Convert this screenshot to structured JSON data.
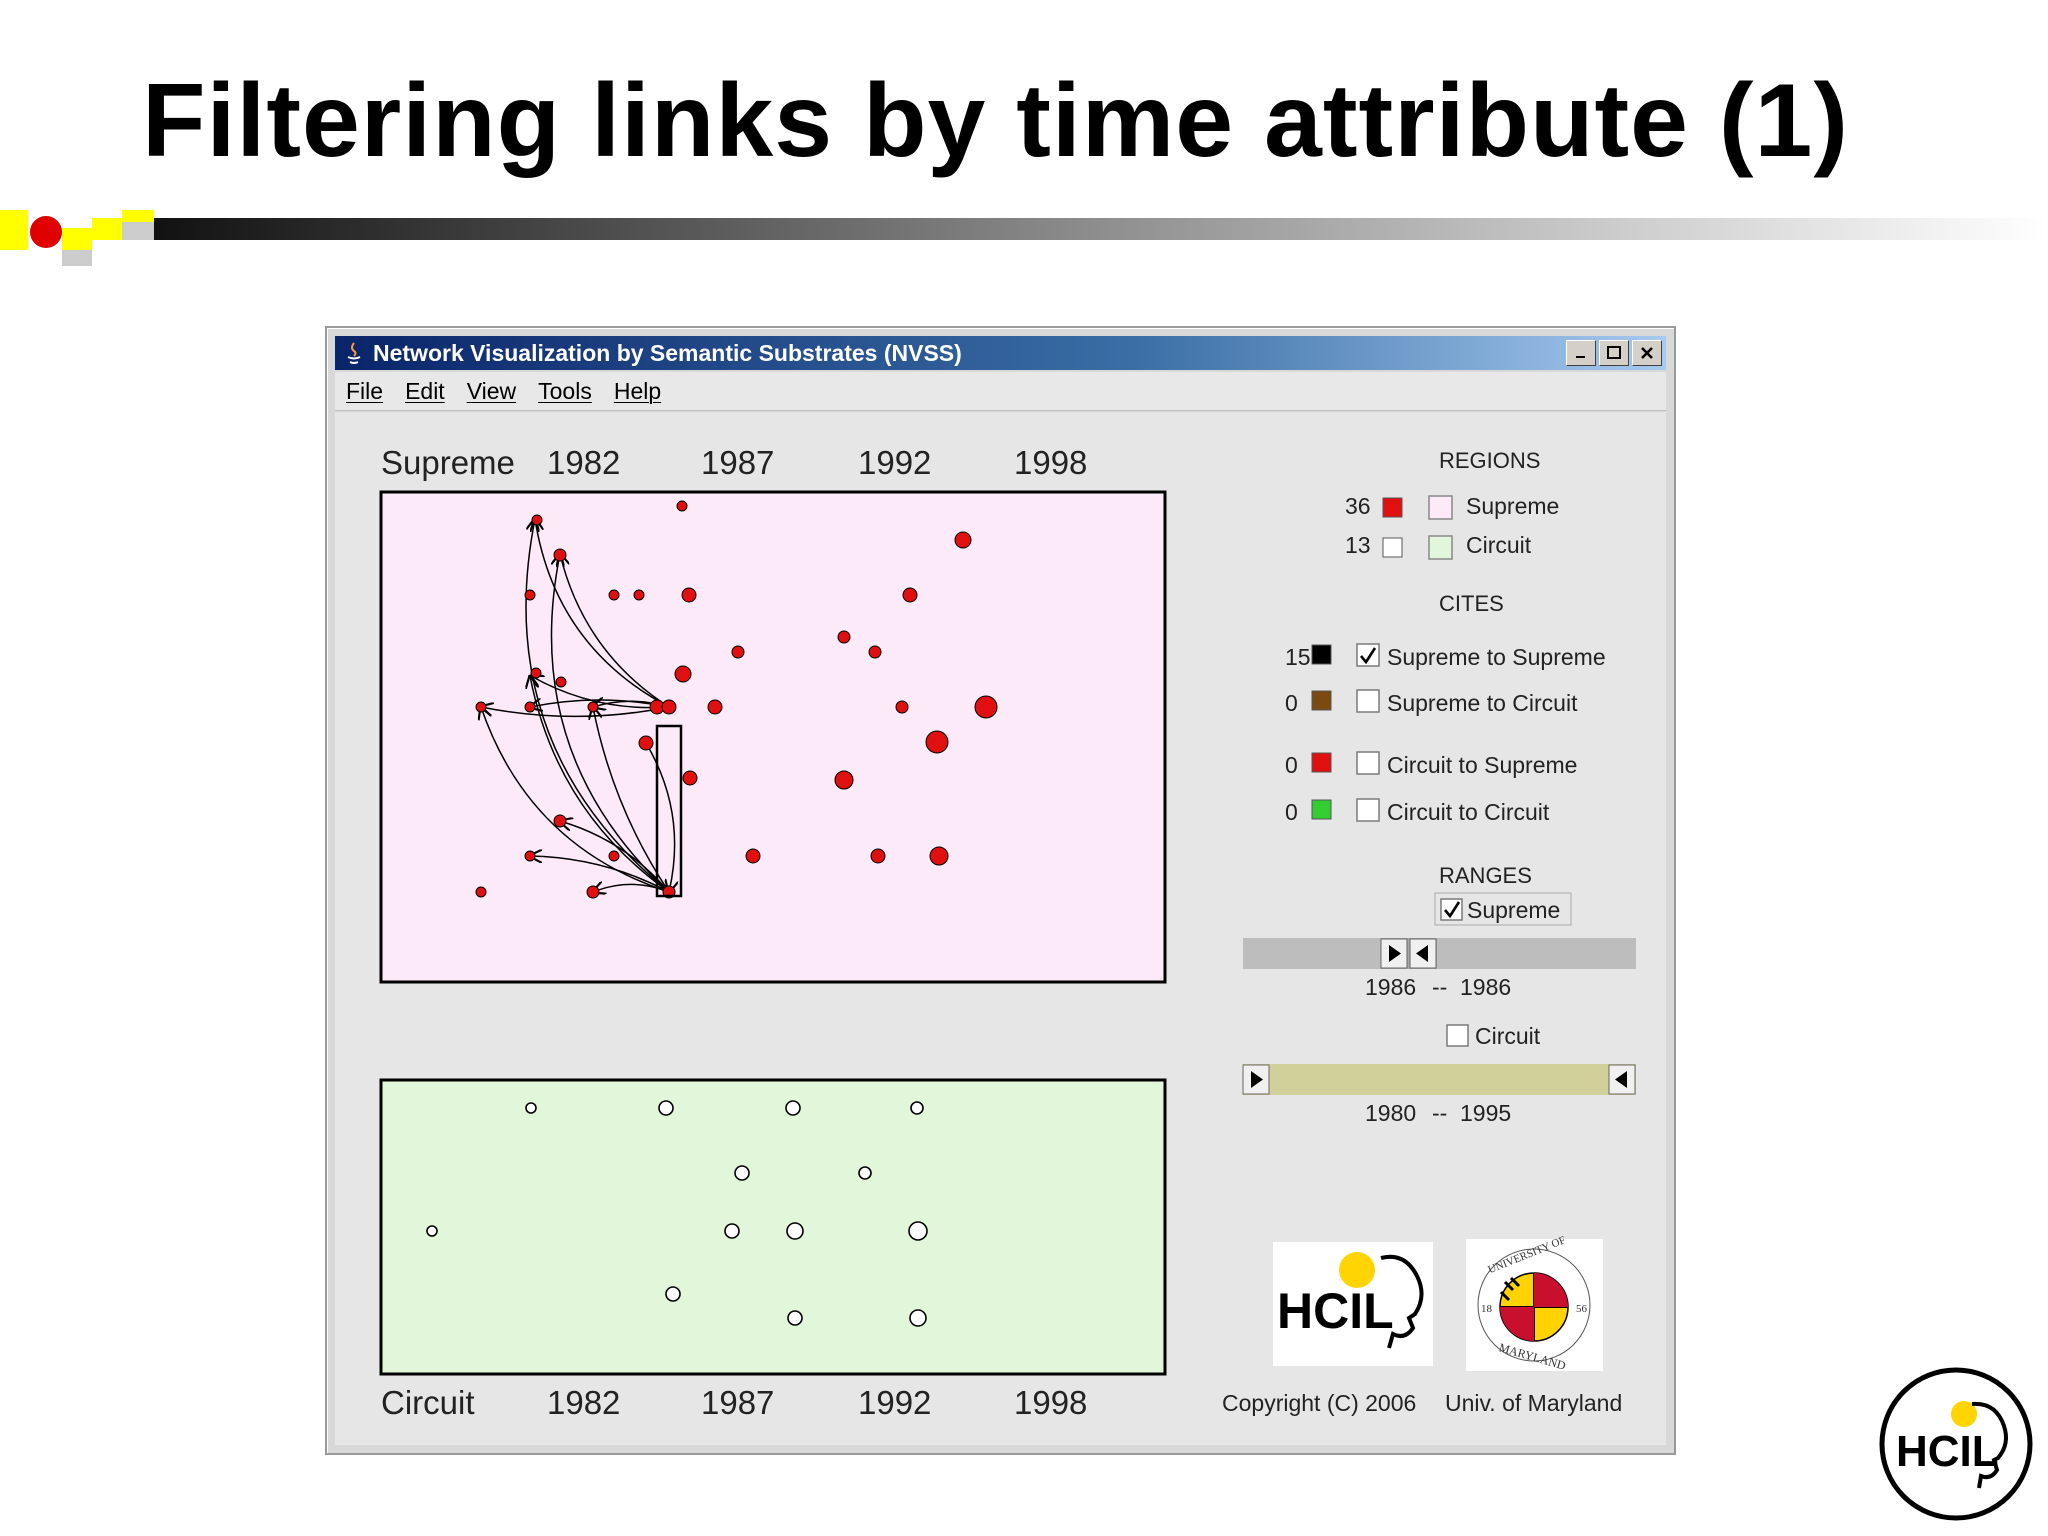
{
  "slide": {
    "title": "Filtering links by time attribute (1)"
  },
  "window": {
    "title": "Network Visualization by Semantic Substrates (NVSS)",
    "menu": [
      "File",
      "Edit",
      "View",
      "Tools",
      "Help"
    ]
  },
  "top_panel": {
    "label": "Supreme",
    "years": [
      "1982",
      "1987",
      "1992",
      "1998"
    ],
    "fill": "#fceaf8"
  },
  "bottom_panel": {
    "label": "Circuit",
    "years": [
      "1982",
      "1987",
      "1992",
      "1998"
    ],
    "fill": "#e2f6da"
  },
  "regions": {
    "heading": "REGIONS",
    "items": [
      {
        "count": "36",
        "label": "Supreme",
        "swatch": "#e01010",
        "region_color": "#fceaf8"
      },
      {
        "count": "13",
        "label": "Circuit",
        "swatch": "#ffffff",
        "region_color": "#e2f6da"
      }
    ]
  },
  "cites": {
    "heading": "CITES",
    "items": [
      {
        "count": "15",
        "label": "Supreme to Supreme",
        "color": "#000000",
        "checked": true
      },
      {
        "count": "0",
        "label": "Supreme to Circuit",
        "color": "#7a4a10",
        "checked": false
      },
      {
        "count": "0",
        "label": "Circuit to Supreme",
        "color": "#e01010",
        "checked": false
      },
      {
        "count": "0",
        "label": "Circuit to Circuit",
        "color": "#33cc33",
        "checked": false
      }
    ]
  },
  "ranges": {
    "heading": "RANGES",
    "supreme": {
      "label": "Supreme",
      "checked": true,
      "from": "1986",
      "separator": "--",
      "to": "1986"
    },
    "circuit": {
      "label": "Circuit",
      "checked": false,
      "from": "1980",
      "separator": "--",
      "to": "1995"
    }
  },
  "logos": {
    "hcil_text": "HCIL",
    "umd_ring_top": "UNIVERSITY OF",
    "umd_ring_bottom": "MARYLAND",
    "umd_left": "18",
    "umd_right": "56"
  },
  "copyright": {
    "left": "Copyright (C) 2006",
    "right": "Univ. of Maryland"
  },
  "corner_logo": "HCIL",
  "colors": {
    "node_supreme": "#e01010",
    "link": "#000000"
  }
}
